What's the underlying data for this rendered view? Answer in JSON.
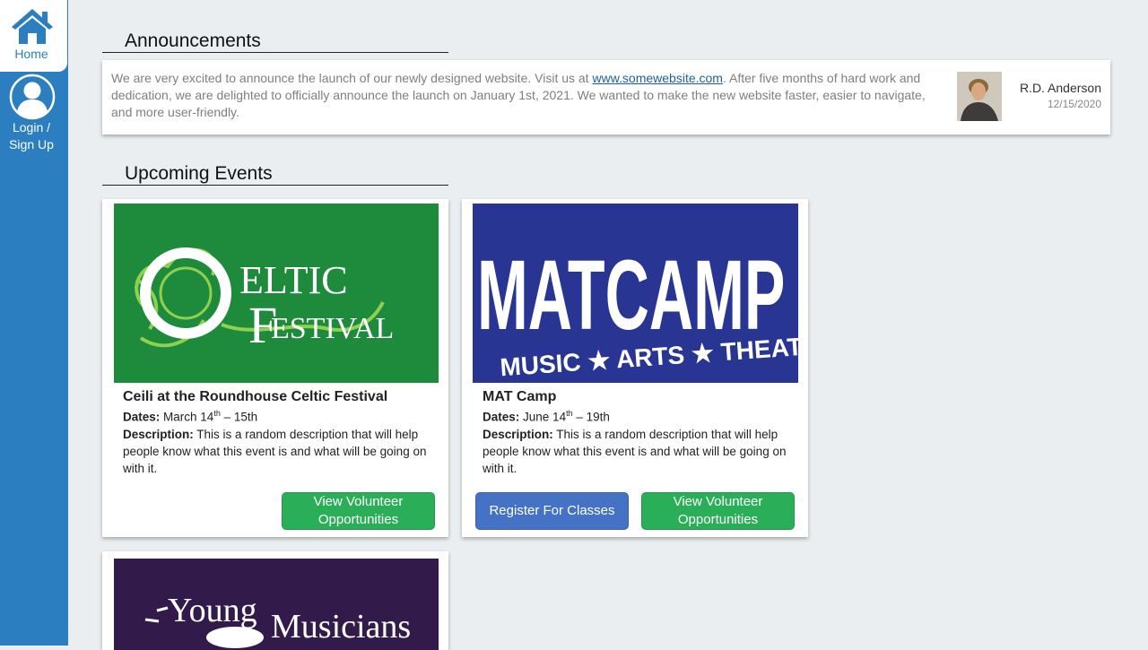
{
  "sidebar": {
    "home_label": "Home",
    "login_label_1": "Login /",
    "login_label_2": "Sign Up"
  },
  "announcements": {
    "title": "Announcements",
    "text_before_link": "We are very excited to announce the launch of our newly designed website. Visit us at ",
    "link_text": "www.somewebsite.com",
    "text_after_link": ".  After five months of hard work and dedication, we are delighted to officially announce the launch on January 1st, 2021. We wanted to make the new website faster, easier to navigate, and more  user-friendly.",
    "author": "R.D. Anderson",
    "date": "12/15/2020"
  },
  "upcoming": {
    "title": "Upcoming Events",
    "events": [
      {
        "title": "Ceili at the Roundhouse Celtic Festival",
        "dates_label": "Dates:",
        "dates_start": "March 14",
        "dates_sup": "th",
        "dates_end": " – 15th",
        "desc_label": "Description:",
        "desc": "This is a random description that will help people know  what this event is and what will be going on with it.",
        "volunteer_button": "View Volunteer Opportunities",
        "logo_line1": "ELTIC",
        "logo_line2": "ESTIVAL"
      },
      {
        "title": "MAT Camp",
        "dates_label": "Dates:",
        "dates_start": "June 14",
        "dates_sup": "th",
        "dates_end": " – 19th",
        "desc_label": "Description:",
        "desc": "This is a random description that will help people know  what this event is and what will be going on with it.",
        "register_button": "Register For Classes",
        "volunteer_button": "View Volunteer Opportunities",
        "logo_line1": "MATCAMP",
        "logo_line2": "MUSIC ★ ARTS ★ THEATRE"
      },
      {
        "logo_line1": "Young",
        "logo_line2": "Musicians"
      }
    ]
  },
  "colors": {
    "sidebar": "#2b7fc0",
    "page_bg": "#eaeef0",
    "button_green": "#2aaf58",
    "button_blue": "#4472c4",
    "celtic_green": "#1e8a3c",
    "matcamp_blue": "#283593",
    "young_purple": "#321a4a"
  },
  "icons": [
    "home-icon",
    "user-circle-icon"
  ]
}
